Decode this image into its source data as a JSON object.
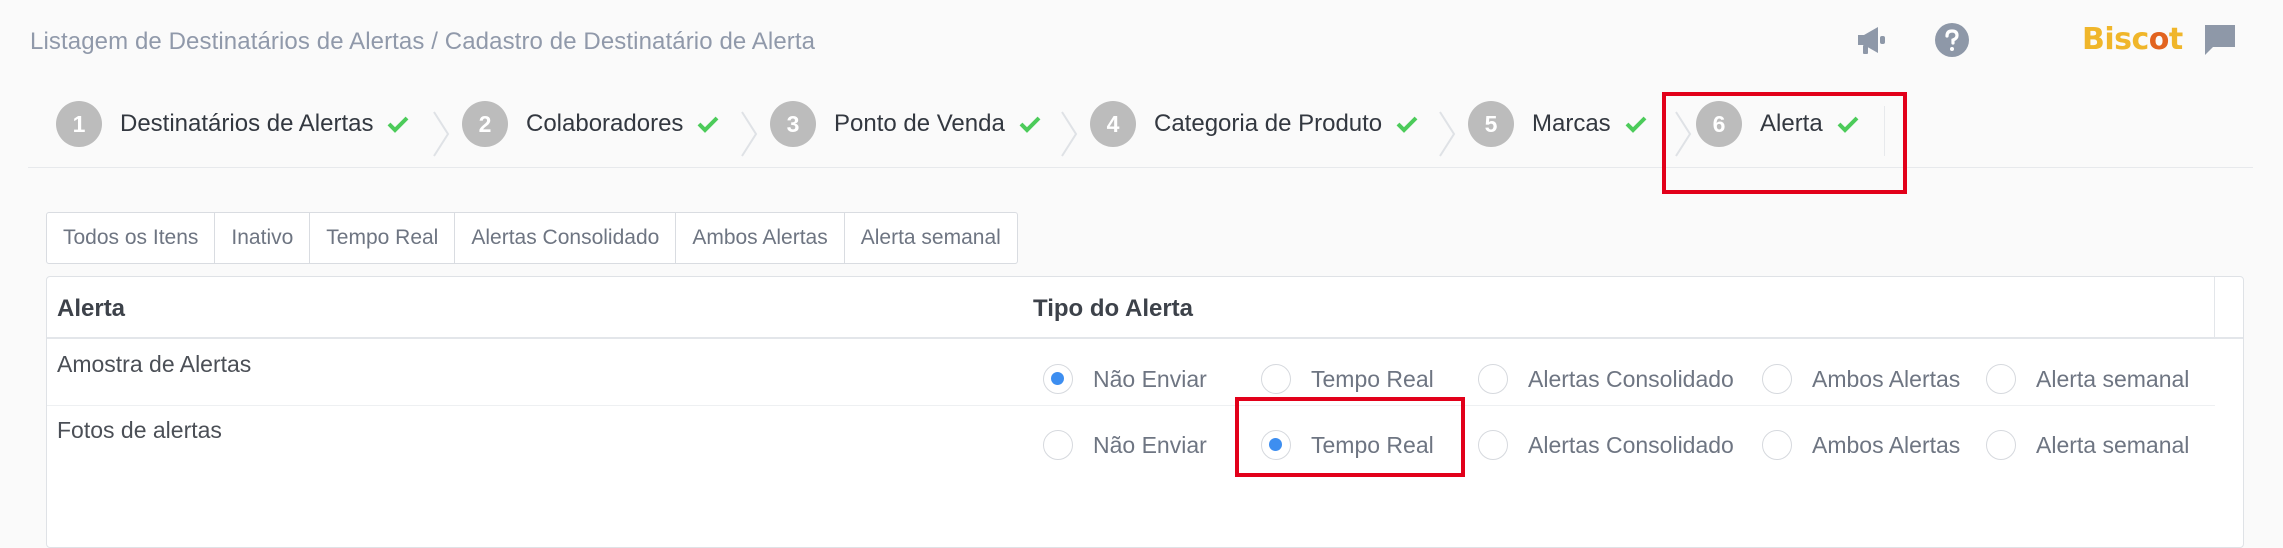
{
  "breadcrumb": {
    "parent": "Listagem de Destinatários de Alertas",
    "separator": " / ",
    "current": "Cadastro de Destinatário de Alerta"
  },
  "header_icons": [
    "megaphone-icon",
    "help-icon",
    "chat-icon"
  ],
  "logo": {
    "text_main": "Bisc",
    "text_dot": "o",
    "text_end": "t"
  },
  "colors": {
    "accent_red": "#e2001a",
    "check_green": "#4ccb5a",
    "radio_blue": "#3d8ef0",
    "logo_yellow": "#f0b62a"
  },
  "steps": [
    {
      "number": "1",
      "label": "Destinatários de Alertas"
    },
    {
      "number": "2",
      "label": "Colaboradores"
    },
    {
      "number": "3",
      "label": "Ponto de Venda"
    },
    {
      "number": "4",
      "label": "Categoria de Produto"
    },
    {
      "number": "5",
      "label": "Marcas"
    },
    {
      "number": "6",
      "label": "Alerta"
    }
  ],
  "filters": [
    "Todos os Itens",
    "Inativo",
    "Tempo Real",
    "Alertas Consolidado",
    "Ambos Alertas",
    "Alerta semanal"
  ],
  "table": {
    "headers": {
      "alerta": "Alerta",
      "tipo": "Tipo do Alerta"
    },
    "options": [
      "Não Enviar",
      "Tempo Real",
      "Alertas Consolidado",
      "Ambos Alertas",
      "Alerta semanal"
    ],
    "rows": [
      {
        "name": "Amostra de Alertas",
        "selected": "Não Enviar"
      },
      {
        "name": "Fotos de alertas",
        "selected": "Tempo Real"
      }
    ]
  }
}
